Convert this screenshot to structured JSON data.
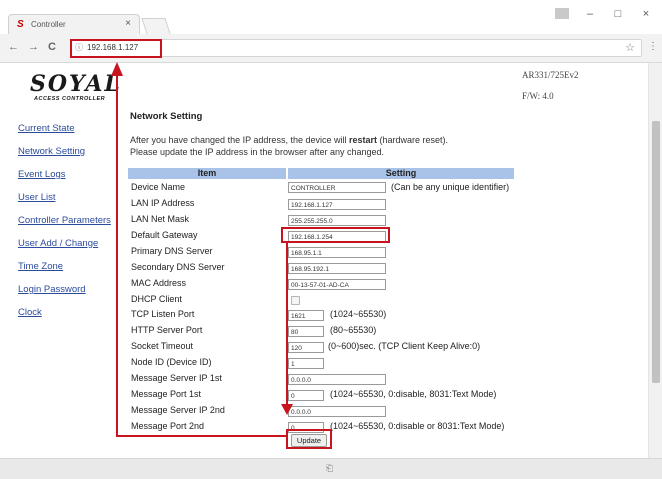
{
  "browser": {
    "tab_title": "Controller",
    "tab_icon": "S",
    "tab_close": "×",
    "url": "192.168.1.127",
    "controls": {
      "minimize": "–",
      "maximize": "□",
      "close": "×",
      "back": "←",
      "forward": "→",
      "reload": "C",
      "star": "☆",
      "menu": "⋮",
      "page_icon": "ⓘ"
    }
  },
  "header": {
    "logo": "SOYAL",
    "logo_sub": "ACCESS CONTROLLER",
    "model": "AR331/725Ev2",
    "firmware": "F/W: 4.0"
  },
  "sidebar": {
    "items": [
      {
        "label": "Current State"
      },
      {
        "label": "Network Setting"
      },
      {
        "label": "Event Logs"
      },
      {
        "label": "User List"
      },
      {
        "label": "Controller Parameters"
      },
      {
        "label": "User Add / Change"
      },
      {
        "label": "Time Zone"
      },
      {
        "label": "Login Password"
      },
      {
        "label": "Clock"
      }
    ]
  },
  "main": {
    "title": "Network Setting",
    "notice_line1_a": "After you have changed the IP address, the device will ",
    "notice_line1_bold": "restart",
    "notice_line1_b": " (hardware reset).",
    "notice_line2": "Please update the IP address in the browser after any changed.",
    "table_headers": {
      "item": "Item",
      "setting": "Setting"
    },
    "rows": [
      {
        "label": "Device Name",
        "value": "CONTROLLER",
        "hint": "(Can be any unique identifier)"
      },
      {
        "label": "LAN IP Address",
        "value": "192.168.1.127",
        "hint": ""
      },
      {
        "label": "LAN Net Mask",
        "value": "255.255.255.0",
        "hint": ""
      },
      {
        "label": "Default Gateway",
        "value": "192.168.1.254",
        "hint": ""
      },
      {
        "label": "Primary DNS Server",
        "value": "168.95.1.1",
        "hint": ""
      },
      {
        "label": "Secondary DNS Server",
        "value": "168.95.192.1",
        "hint": ""
      },
      {
        "label": "MAC Address",
        "value": "00-13-57-01-AD-CA",
        "hint": ""
      },
      {
        "label": "DHCP Client",
        "value": "",
        "hint": "",
        "checked": false
      },
      {
        "label": "TCP Listen Port",
        "value": "1621",
        "hint": "(1024~65530)"
      },
      {
        "label": "HTTP Server Port",
        "value": "80",
        "hint": "(80~65530)"
      },
      {
        "label": "Socket Timeout",
        "value": "120",
        "hint": "(0~600)sec. (TCP Client Keep Alive:0)"
      },
      {
        "label": "Node ID (Device ID)",
        "value": "1",
        "hint": ""
      },
      {
        "label": "Message Server IP 1st",
        "value": "0.0.0.0",
        "hint": ""
      },
      {
        "label": "Message Port 1st",
        "value": "0",
        "hint": "(1024~65530, 0:disable,  8031:Text Mode)"
      },
      {
        "label": "Message Server IP 2nd",
        "value": "0.0.0.0",
        "hint": ""
      },
      {
        "label": "Message Port 2nd",
        "value": "0",
        "hint": "(1024~65530, 0:disable or 8031:Text Mode)"
      }
    ],
    "update_label": "Update"
  },
  "status_icon": "⎗",
  "colors": {
    "annotation_red": "#c8141e",
    "table_header": "#a8c3e7",
    "link": "#2b4b9b"
  }
}
